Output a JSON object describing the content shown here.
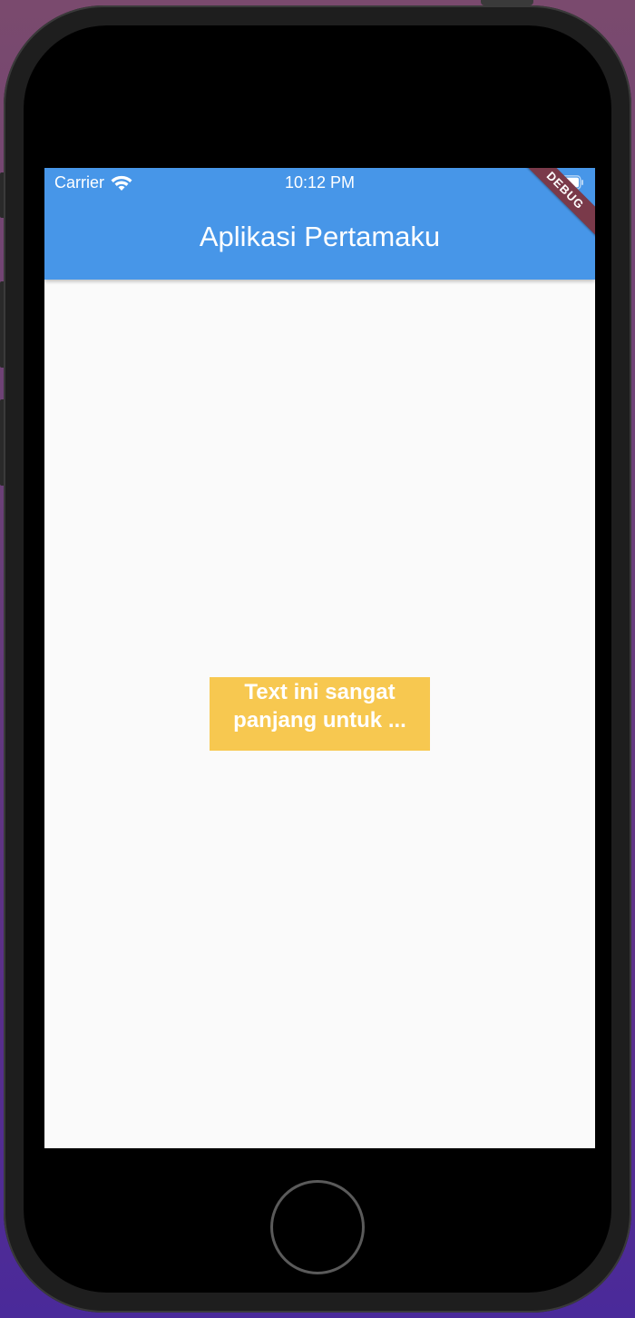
{
  "status_bar": {
    "carrier": "Carrier",
    "time": "10:12 PM"
  },
  "app_bar": {
    "title": "Aplikasi Pertamaku",
    "background_color": "#4796e8"
  },
  "debug_banner": {
    "label": "DEBUG"
  },
  "body": {
    "text_box": {
      "text": "Text ini sangat panjang untuk ...",
      "background_color": "#f7c850"
    }
  },
  "icons": {
    "wifi": "wifi-icon",
    "battery": "battery-icon",
    "home": "home-button"
  }
}
